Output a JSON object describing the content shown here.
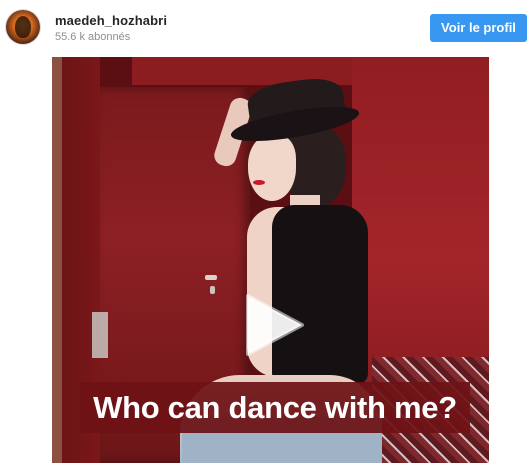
{
  "header": {
    "username": "maedeh_hozhabri",
    "followers": "55.6 k abonnés",
    "profile_button_label": "Voir le profil",
    "avatar_icon": "profile-avatar"
  },
  "video": {
    "caption": "Who can dance with me?",
    "play_icon": "play-icon"
  },
  "colors": {
    "accent": "#3897f0",
    "username_text": "#262626",
    "secondary_text": "#8e8e8e",
    "caption_bg": "#6e1216"
  }
}
